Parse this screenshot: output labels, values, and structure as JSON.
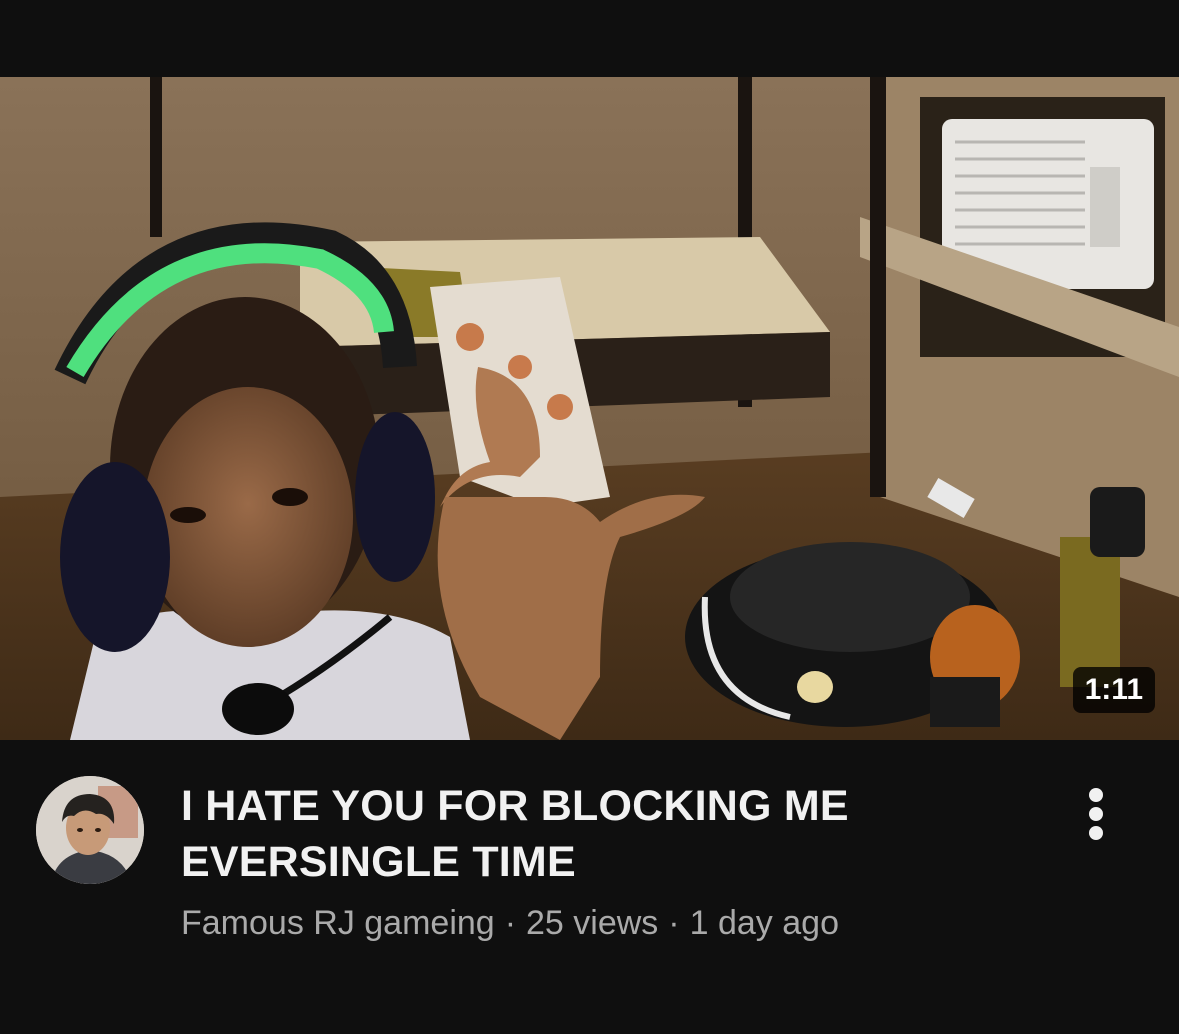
{
  "video": {
    "title": "I HATE YOU FOR BLOCKING ME EVERSINGLE TIME",
    "duration": "1:11",
    "channel_name": "Famous RJ gameing",
    "view_count": "25 views",
    "upload_age": "1 day ago",
    "separator": "·"
  },
  "icons": {
    "more_menu": "vertical-ellipsis-icon",
    "avatar": "channel-avatar"
  },
  "colors": {
    "background": "#0f0f0f",
    "title_text": "#f1f1f1",
    "meta_text": "#aaaaaa",
    "badge_bg": "#000000"
  }
}
